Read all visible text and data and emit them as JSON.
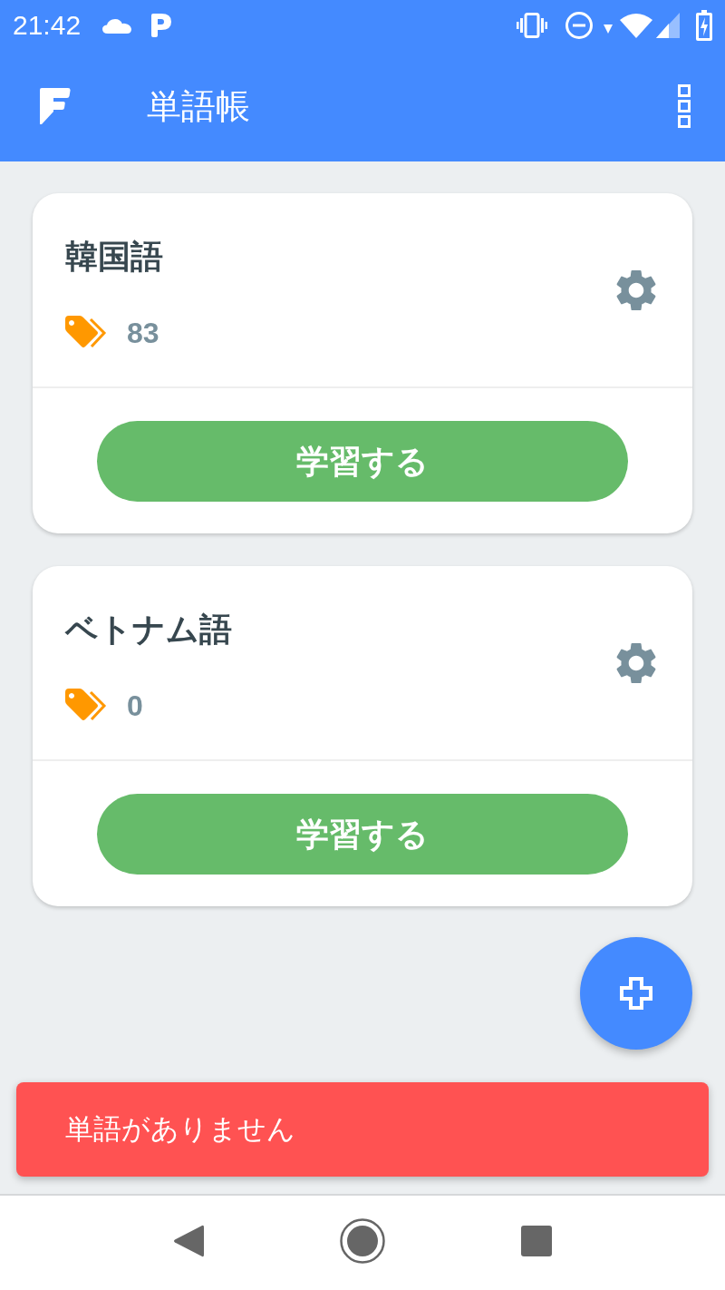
{
  "status_bar": {
    "time": "21:42"
  },
  "app_bar": {
    "title": "単語帳"
  },
  "decks": [
    {
      "name": "韓国語",
      "count": "83",
      "button": "学習する"
    },
    {
      "name": "ベトナム語",
      "count": "0",
      "button": "学習する"
    }
  ],
  "snackbar": {
    "message": "単語がありません"
  }
}
